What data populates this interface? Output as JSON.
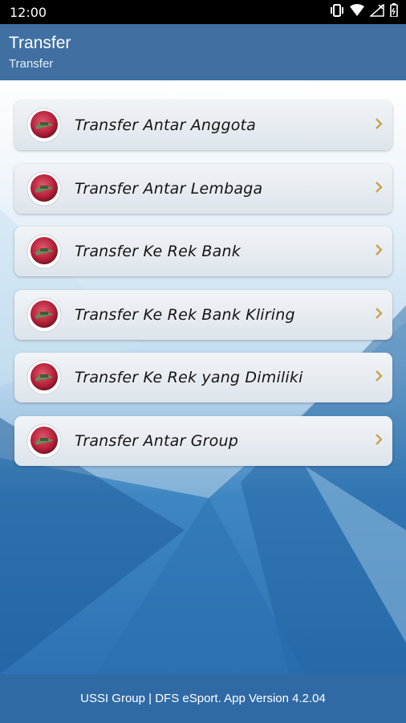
{
  "status_bar": {
    "time": "12:00"
  },
  "app_bar": {
    "title": "Transfer",
    "subtitle": "Transfer"
  },
  "menu": {
    "items": [
      {
        "label": "Transfer Antar Anggota"
      },
      {
        "label": "Transfer Antar Lembaga"
      },
      {
        "label": "Transfer Ke Rek Bank"
      },
      {
        "label": "Transfer Ke Rek Bank Kliring"
      },
      {
        "label": "Transfer Ke Rek yang Dimiliki"
      },
      {
        "label": "Transfer Antar Group"
      }
    ]
  },
  "footer": {
    "text": "USSI Group | DFS eSport. App Version 4.2.04"
  },
  "colors": {
    "app_bar": "#3f70a1",
    "footer": "#2f6aa5",
    "chevron": "#c8a24a",
    "icon_red": "#b5213a"
  }
}
